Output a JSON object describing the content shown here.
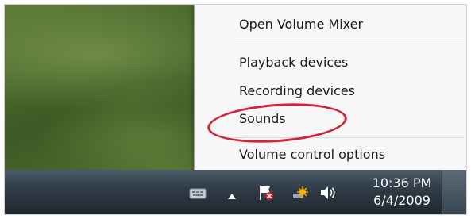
{
  "menu": {
    "items": [
      {
        "label": "Open Volume Mixer"
      },
      {
        "label": "Playback devices"
      },
      {
        "label": "Recording devices"
      },
      {
        "label": "Sounds",
        "highlighted": true
      },
      {
        "label": "Volume control options"
      }
    ],
    "highlight_color": "#d0263b"
  },
  "taskbar": {
    "clock_time": "10:36 PM",
    "clock_date": "6/4/2009",
    "icons": [
      "keyboard-icon",
      "show-hidden-icons-arrow",
      "action-center-flag-icon",
      "network-icon",
      "volume-icon"
    ]
  }
}
